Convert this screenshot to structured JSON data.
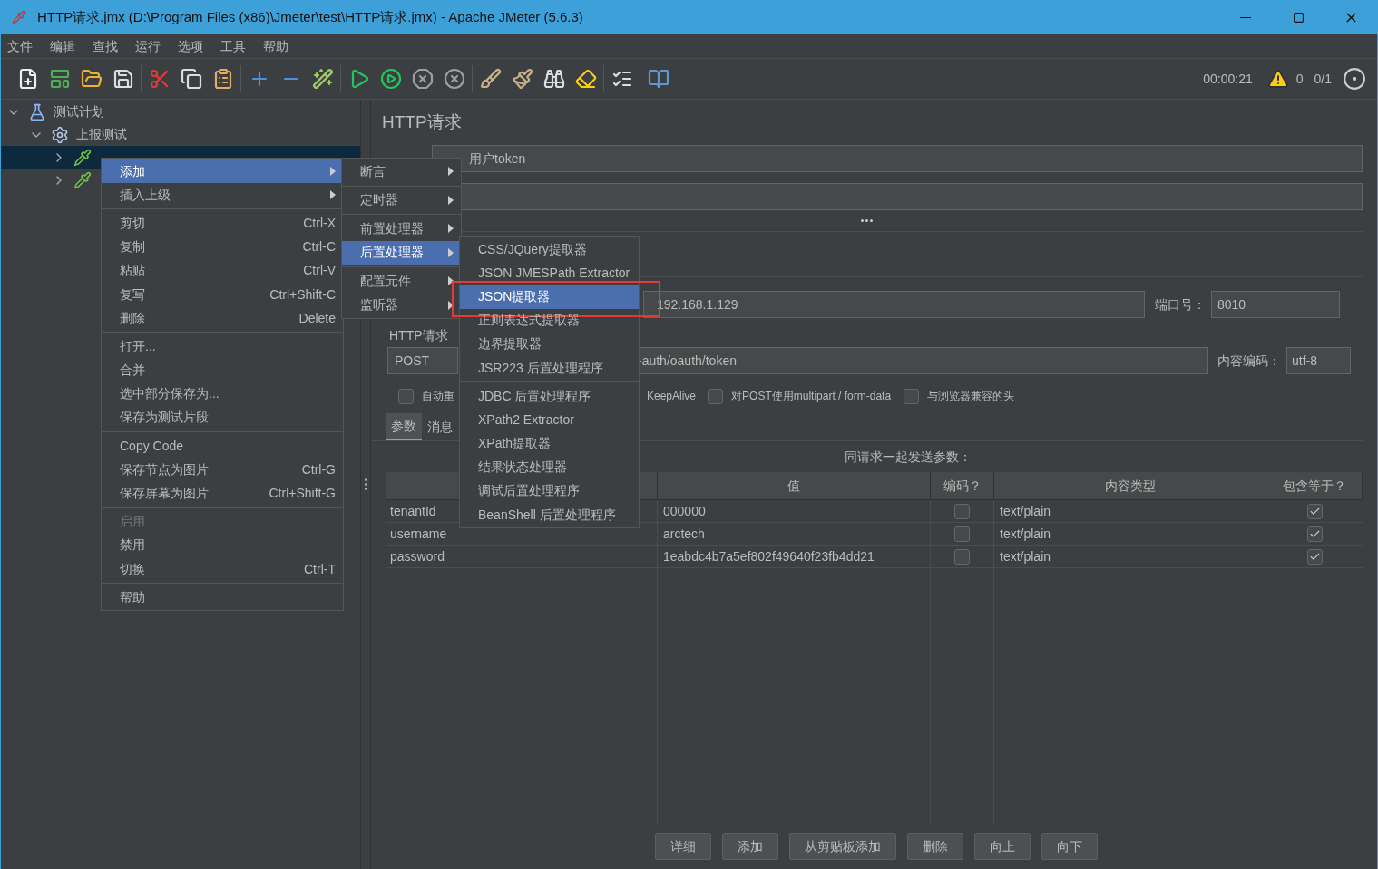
{
  "window": {
    "title": "HTTP请求.jmx (D:\\Program Files (x86)\\Jmeter\\test\\HTTP请求.jmx) - Apache JMeter (5.6.3)"
  },
  "menu_bar": [
    "文件",
    "编辑",
    "查找",
    "运行",
    "选项",
    "工具",
    "帮助"
  ],
  "status": {
    "elapsed": "00:00:21",
    "errors": "0",
    "threads": "0/1"
  },
  "tree": [
    {
      "label": "测试计划",
      "expanded": true,
      "selected": false,
      "children": [
        {
          "label": "上报测试",
          "expanded": true,
          "selected": false,
          "children": [
            {
              "expanded": false,
              "selected": true
            },
            {
              "expanded": false,
              "selected": false
            }
          ]
        }
      ]
    }
  ],
  "panel": {
    "title": "HTTP请求",
    "name_value": "用户token",
    "server_value": "192.168.1.129",
    "port_label": "端口号：",
    "port_value": "8010",
    "group_label": "HTTP请求",
    "method_value": "POST",
    "path_value": "-auth/oauth/token",
    "encoding_label": "内容编码：",
    "encoding_value": "utf-8",
    "options": [
      {
        "label": "自动重",
        "checked": false
      },
      {
        "label": "KeepAlive"
      },
      {
        "label": "对POST使用multipart / form-data",
        "checked": false
      },
      {
        "label": "与浏览器兼容的头",
        "checked": false
      }
    ],
    "tabs": [
      {
        "label": "参数",
        "selected": true
      },
      {
        "label": "消息",
        "selected": false
      }
    ],
    "table_title": "同请求一起发送参数：",
    "columns": [
      "值",
      "编码？",
      "内容类型",
      "包含等于？"
    ],
    "rows": [
      {
        "name": "tenantId",
        "value": "000000",
        "encode": false,
        "content_type": "text/plain",
        "include_equals": true
      },
      {
        "name": "username",
        "value": "arctech",
        "encode": false,
        "content_type": "text/plain",
        "include_equals": true
      },
      {
        "name": "password",
        "value": "1eabdc4b7a5ef802f49640f23fb4dd21",
        "encode": false,
        "content_type": "text/plain",
        "include_equals": true
      }
    ],
    "buttons": [
      "详细",
      "添加",
      "从剪贴板添加",
      "删除",
      "向上",
      "向下"
    ]
  },
  "context_menu": [
    {
      "kind": "item",
      "label": "添加",
      "submenu": true,
      "selected": true,
      "disabled": false
    },
    {
      "kind": "item",
      "label": "插入上级",
      "submenu": true,
      "selected": false,
      "disabled": false
    },
    {
      "kind": "separator"
    },
    {
      "kind": "item",
      "label": "剪切",
      "shortcut": "Ctrl-X",
      "selected": false,
      "disabled": false
    },
    {
      "kind": "item",
      "label": "复制",
      "shortcut": "Ctrl-C",
      "selected": false,
      "disabled": false
    },
    {
      "kind": "item",
      "label": "粘贴",
      "shortcut": "Ctrl-V",
      "selected": false,
      "disabled": false
    },
    {
      "kind": "item",
      "label": "复写",
      "shortcut": "Ctrl+Shift-C",
      "selected": false,
      "disabled": false
    },
    {
      "kind": "item",
      "label": "删除",
      "shortcut": "Delete",
      "selected": false,
      "disabled": false
    },
    {
      "kind": "separator"
    },
    {
      "kind": "item",
      "label": "打开...",
      "selected": false,
      "disabled": false
    },
    {
      "kind": "item",
      "label": "合并",
      "selected": false,
      "disabled": false
    },
    {
      "kind": "item",
      "label": "选中部分保存为...",
      "selected": false,
      "disabled": false
    },
    {
      "kind": "item",
      "label": "保存为测试片段",
      "selected": false,
      "disabled": false
    },
    {
      "kind": "separator"
    },
    {
      "kind": "item",
      "label": "Copy Code",
      "selected": false,
      "disabled": false
    },
    {
      "kind": "item",
      "label": "保存节点为图片",
      "shortcut": "Ctrl-G",
      "selected": false,
      "disabled": false
    },
    {
      "kind": "item",
      "label": "保存屏幕为图片",
      "shortcut": "Ctrl+Shift-G",
      "selected": false,
      "disabled": false
    },
    {
      "kind": "separator"
    },
    {
      "kind": "item",
      "label": "启用",
      "selected": false,
      "disabled": true
    },
    {
      "kind": "item",
      "label": "禁用",
      "selected": false,
      "disabled": false
    },
    {
      "kind": "item",
      "label": "切换",
      "shortcut": "Ctrl-T",
      "selected": false,
      "disabled": false
    },
    {
      "kind": "separator"
    },
    {
      "kind": "item",
      "label": "帮助",
      "selected": false,
      "disabled": false
    }
  ],
  "add_submenu": [
    {
      "kind": "item",
      "label": "断言",
      "selected": false
    },
    {
      "kind": "separator"
    },
    {
      "kind": "item",
      "label": "定时器",
      "selected": false
    },
    {
      "kind": "separator"
    },
    {
      "kind": "item",
      "label": "前置处理器",
      "selected": false
    },
    {
      "kind": "item",
      "label": "后置处理器",
      "selected": true
    },
    {
      "kind": "separator"
    },
    {
      "kind": "item",
      "label": "配置元件",
      "selected": false
    },
    {
      "kind": "item",
      "label": "监听器",
      "selected": false
    }
  ],
  "post_processor_submenu": [
    {
      "kind": "item",
      "label": "CSS/JQuery提取器",
      "selected": false,
      "highlighted": false
    },
    {
      "kind": "item",
      "label": "JSON JMESPath Extractor",
      "selected": false,
      "highlighted": false
    },
    {
      "kind": "item",
      "label": "JSON提取器",
      "selected": true,
      "highlighted": true
    },
    {
      "kind": "item",
      "label": "正则表达式提取器",
      "selected": false,
      "highlighted": false
    },
    {
      "kind": "item",
      "label": "边界提取器",
      "selected": false,
      "highlighted": false
    },
    {
      "kind": "item",
      "label": "JSR223 后置处理程序",
      "selected": false,
      "highlighted": false
    },
    {
      "kind": "separator"
    },
    {
      "kind": "item",
      "label": "JDBC 后置处理程序",
      "selected": false,
      "highlighted": false
    },
    {
      "kind": "item",
      "label": "XPath2 Extractor",
      "selected": false,
      "highlighted": false
    },
    {
      "kind": "item",
      "label": "XPath提取器",
      "selected": false,
      "highlighted": false
    },
    {
      "kind": "item",
      "label": "结果状态处理器",
      "selected": false,
      "highlighted": false
    },
    {
      "kind": "item",
      "label": "调试后置处理程序",
      "selected": false,
      "highlighted": false
    },
    {
      "kind": "item",
      "label": "BeanShell 后置处理程序",
      "selected": false,
      "highlighted": false
    }
  ]
}
